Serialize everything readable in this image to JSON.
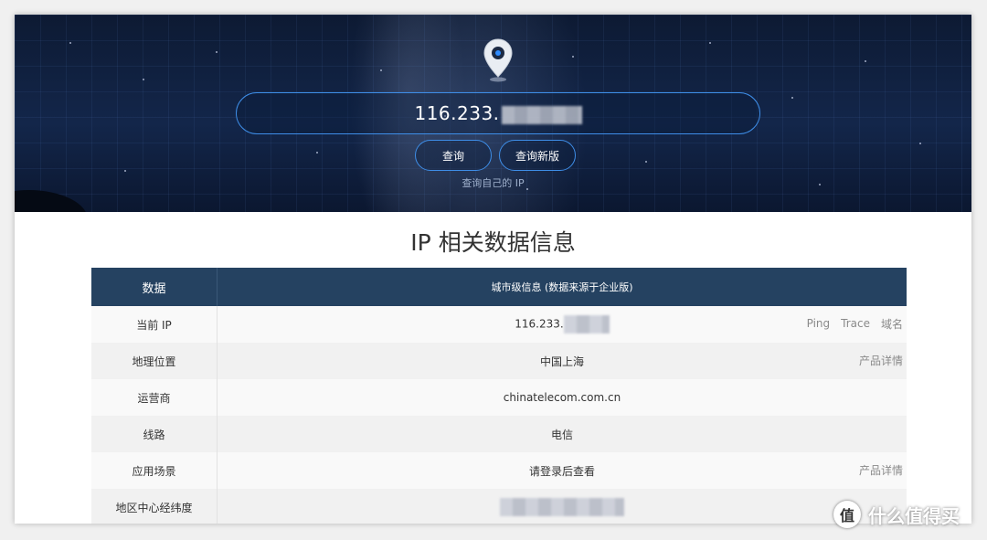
{
  "hero": {
    "ip_value": "116.233.",
    "query_button": "查询",
    "query_new_button": "查询新版",
    "own_ip_link": "查询自己的 IP",
    "icons": [
      "location-pin-icon"
    ]
  },
  "section": {
    "title": "IP 相关数据信息"
  },
  "table": {
    "headers": [
      "数据",
      "城市级信息 (数据来源于企业版)"
    ],
    "rows": [
      {
        "label": "当前 IP",
        "value": "116.233.",
        "actions": [
          "Ping",
          "Trace",
          "域名"
        ]
      },
      {
        "label": "地理位置",
        "value": "中国上海",
        "actions": [
          "产品详情"
        ]
      },
      {
        "label": "运营商",
        "value": "chinatelecom.com.cn",
        "actions": []
      },
      {
        "label": "线路",
        "value": "电信",
        "actions": []
      },
      {
        "label": "应用场景",
        "value": "请登录后查看",
        "actions": [
          "产品详情"
        ]
      },
      {
        "label": "地区中心经纬度",
        "value": "",
        "actions": []
      }
    ]
  },
  "watermark": {
    "text": "什么值得买",
    "logo_glyph": "值"
  },
  "colors": {
    "accent": "#3e8ee8",
    "header_bg": "#254261",
    "hero_bg": "#13264a"
  }
}
